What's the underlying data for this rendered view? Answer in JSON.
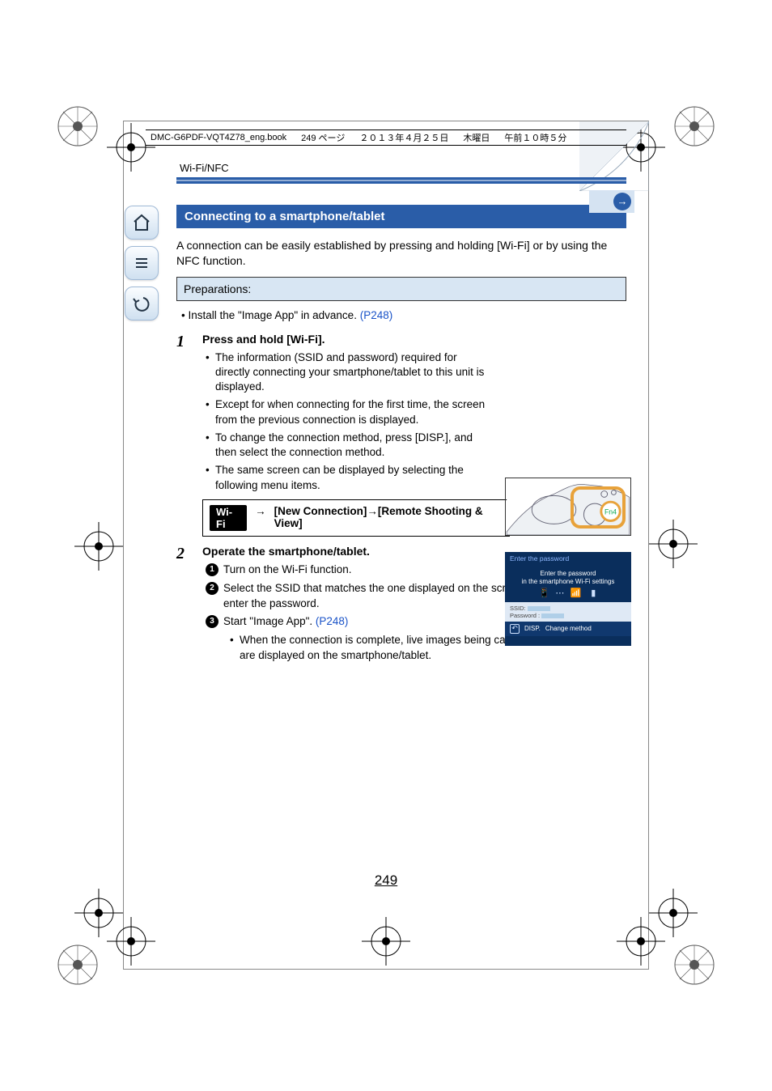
{
  "running_head": {
    "file": "DMC-G6PDF-VQT4Z78_eng.book",
    "page": "249 ページ",
    "date": "２０１３年４月２５日",
    "day": "木曜日",
    "time": "午前１０時５分"
  },
  "breadcrumb": "Wi-Fi/NFC",
  "section_title": "Connecting to a smartphone/tablet",
  "intro": "A connection can be easily established by pressing and holding [Wi-Fi] or by using the NFC function.",
  "prep_label": "Preparations:",
  "install_prefix": "• Install the \"Image App\" in advance. ",
  "install_ref": "(P248)",
  "step1": {
    "num": "1",
    "head": "Press and hold [Wi-Fi].",
    "bullets": [
      "The information (SSID and password) required for directly connecting your smartphone/tablet to this unit is displayed.",
      "Except for when connecting for the first time, the screen from the previous connection is displayed.",
      "To change the connection method, press [DISP.], and then select the connection method.",
      "The same screen can be displayed by selecting the following menu items."
    ],
    "wifi_badge": "Wi-Fi",
    "menu_path": "[New Connection]",
    "menu_path2": "[Remote Shooting & View]"
  },
  "step2": {
    "num": "2",
    "head": "Operate the smartphone/tablet.",
    "items": [
      "Turn on the Wi-Fi function.",
      "Select the SSID that matches the one displayed on the screen of this unit, and then enter the password.",
      "Start \"Image App\". "
    ],
    "item3_ref": "(P248)",
    "sub": "When the connection is complete, live images being captured by the camera are displayed on the smartphone/tablet."
  },
  "screen": {
    "title": "Enter the password",
    "line1": "Enter the password",
    "line2": "in the smartphone Wi-Fi settings",
    "ssid_label": "SSID:",
    "pw_label": "Password :",
    "disp": "DISP.",
    "change": "Change method"
  },
  "camera_button": "Fn4",
  "page_number": "249"
}
